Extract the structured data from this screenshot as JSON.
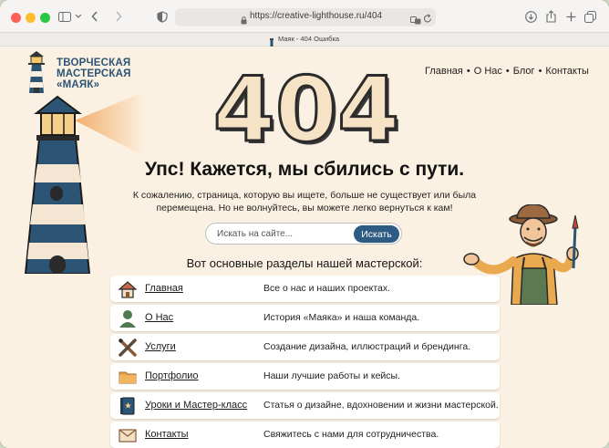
{
  "browser": {
    "url": "https://creative-lighthouse.ru/404",
    "tab_title": "Маяк - 404 Ошибка"
  },
  "logo": {
    "line1": "ТВОРЧЕСКАЯ",
    "line2": "МАСТЕРСКАЯ",
    "line3": "«МАЯК»"
  },
  "nav": {
    "items": [
      "Главная",
      "О Нас",
      "Блог",
      "Контакты"
    ],
    "separator": "•"
  },
  "error": {
    "code": "404",
    "headline": "Упс! Кажется, мы сбились с пути.",
    "message_line1": "К сожалению, страница, которую вы ищете, больше не существует или была",
    "message_line2": "перемещена. Но не волнуйтесь, вы можете легко вернуться к кам!"
  },
  "search": {
    "placeholder": "Искать на сайте...",
    "button_label": "Искать"
  },
  "sections": {
    "title": "Вот основные разделы нашей мастерской:",
    "items": [
      {
        "label": "Главная",
        "description": "Все о нас и наших проектах.",
        "icon": "house-icon"
      },
      {
        "label": "О Нас",
        "description": "История «Маяка» и наша команда.",
        "icon": "person-icon"
      },
      {
        "label": "Услуги",
        "description": "Создание дизайна, иллюстраций и брендинга.",
        "icon": "crossed-tools-icon"
      },
      {
        "label": "Портфолио",
        "description": "Наши лучшие работы и кейсы.",
        "icon": "folder-icon"
      },
      {
        "label": "Уроки и Мастер-класс",
        "description": "Статья о дизайне, вдохновении и жизни мастерской.",
        "icon": "book-icon"
      },
      {
        "label": "Контакты",
        "description": "Свяжитесь с нами для сотрудничества.",
        "icon": "envelope-icon"
      }
    ]
  },
  "colors": {
    "background": "#fbf1e2",
    "brand_blue": "#2c5575",
    "button_blue": "#2d5b84",
    "digits": "#f6e2c4"
  }
}
